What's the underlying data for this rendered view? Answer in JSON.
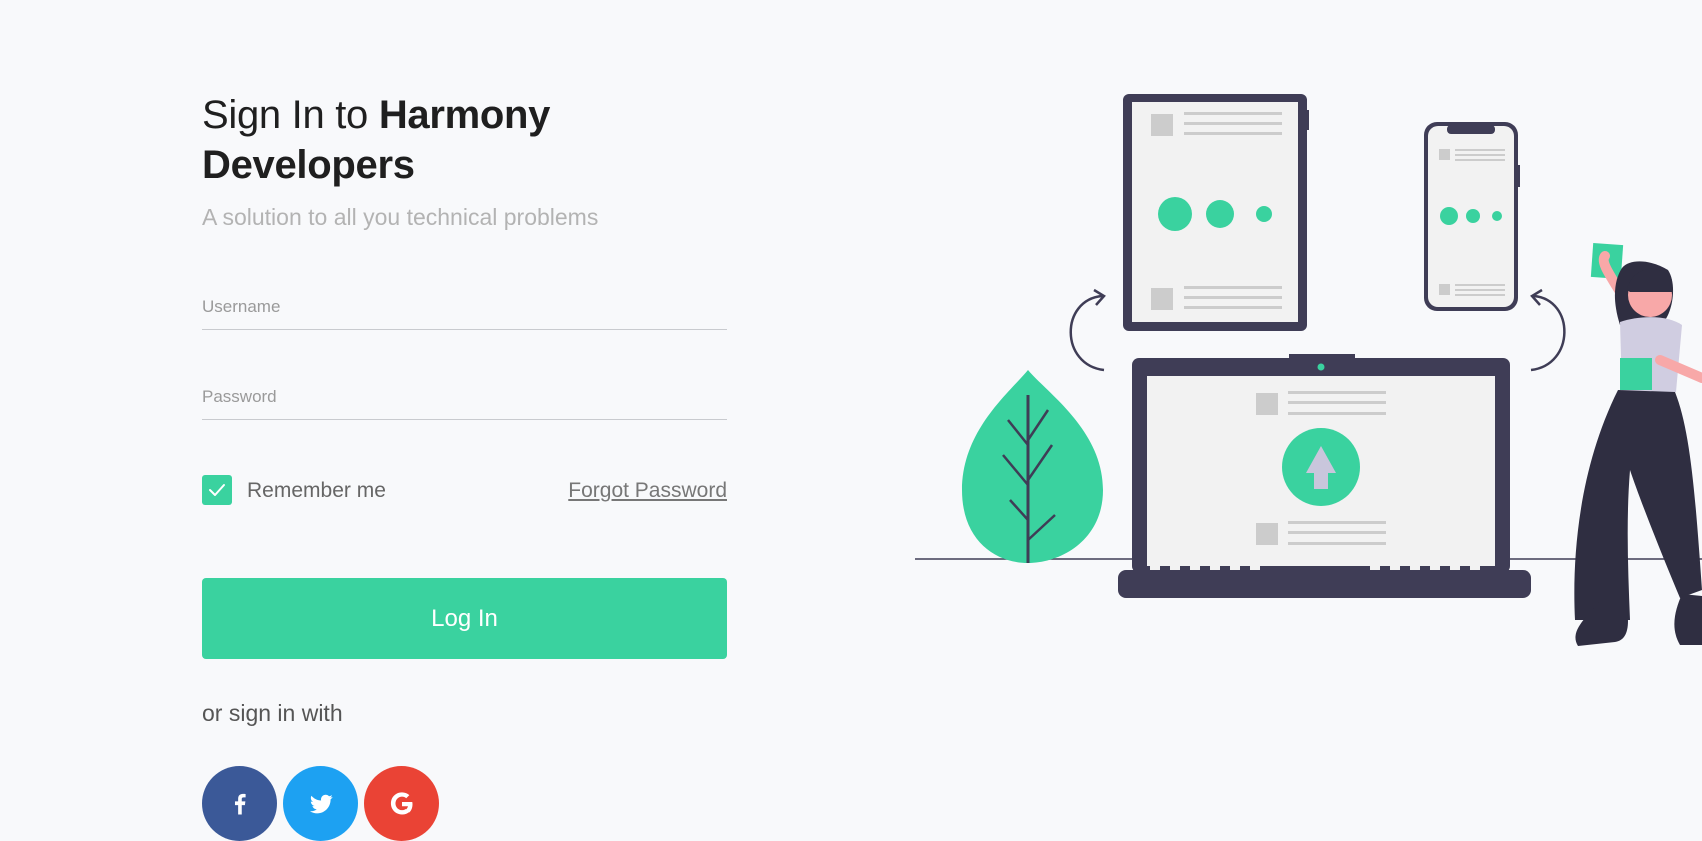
{
  "page": {
    "title_prefix": "Sign In to ",
    "title_brand": "Harmony Developers",
    "subtitle": "A solution to all you technical problems"
  },
  "form": {
    "username_placeholder": "Username",
    "password_placeholder": "Password",
    "remember_label": "Remember me",
    "remember_checked": true,
    "forgot_label": "Forgot Password",
    "login_label": "Log In"
  },
  "social": {
    "or_label": "or sign in with",
    "buttons": [
      {
        "icon": "facebook-icon",
        "color": "#3b5998"
      },
      {
        "icon": "twitter-icon",
        "color": "#1da1f2"
      },
      {
        "icon": "google-icon",
        "color": "#ea4335"
      }
    ]
  },
  "colors": {
    "accent": "#3ad29f",
    "dark": "#3f3d56",
    "background": "#f8f9fb"
  }
}
